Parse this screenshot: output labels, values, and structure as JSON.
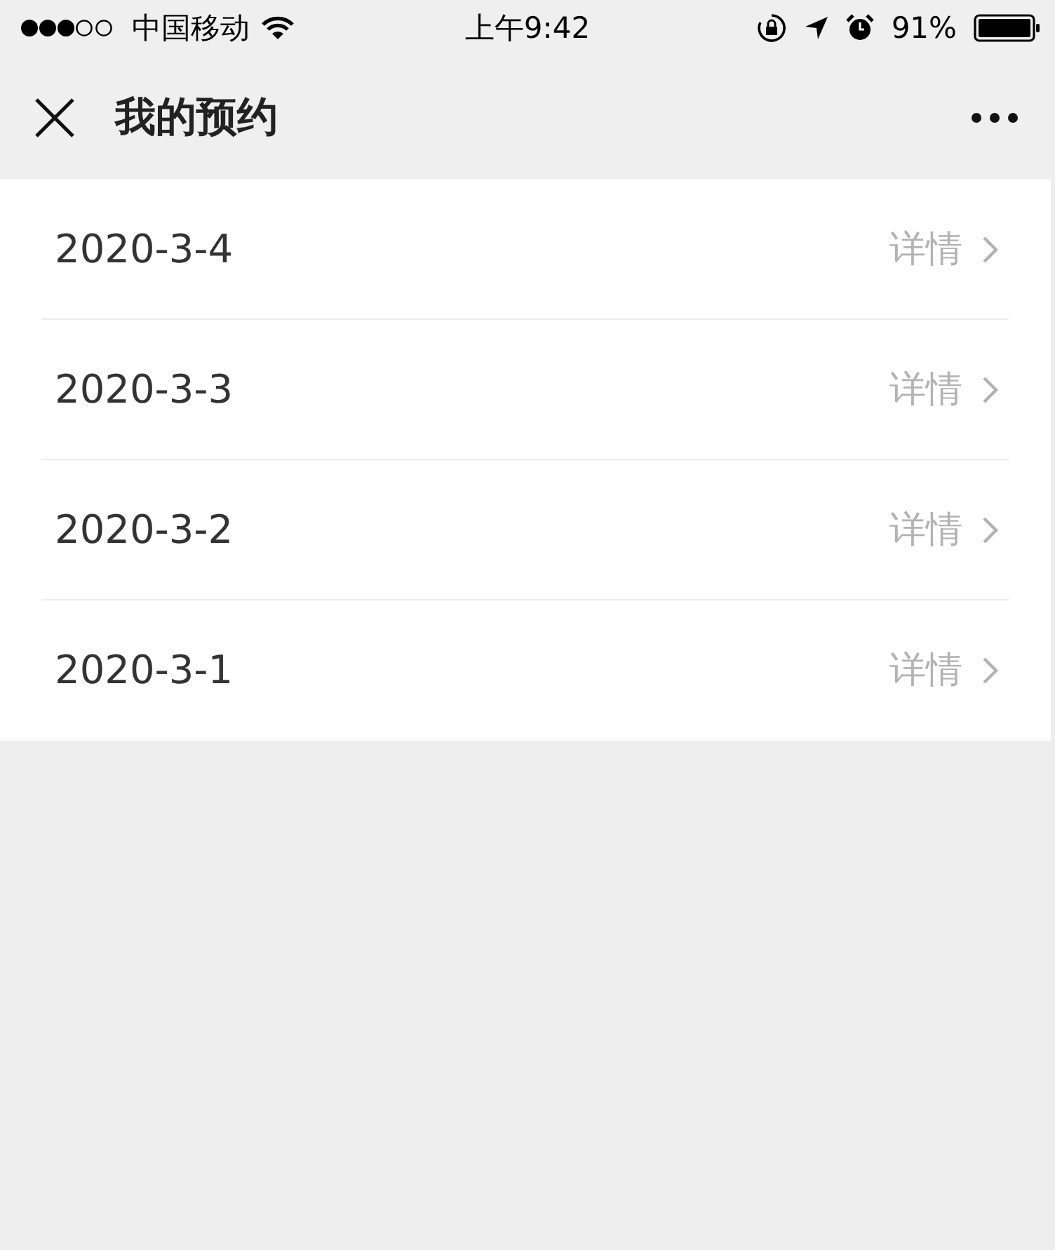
{
  "status_bar": {
    "carrier": "中国移动",
    "time": "上午9:42",
    "battery": "91%"
  },
  "nav": {
    "title": "我的预约"
  },
  "appointments": [
    {
      "date": "2020-3-4",
      "action": "详情"
    },
    {
      "date": "2020-3-3",
      "action": "详情"
    },
    {
      "date": "2020-3-2",
      "action": "详情"
    },
    {
      "date": "2020-3-1",
      "action": "详情"
    }
  ]
}
